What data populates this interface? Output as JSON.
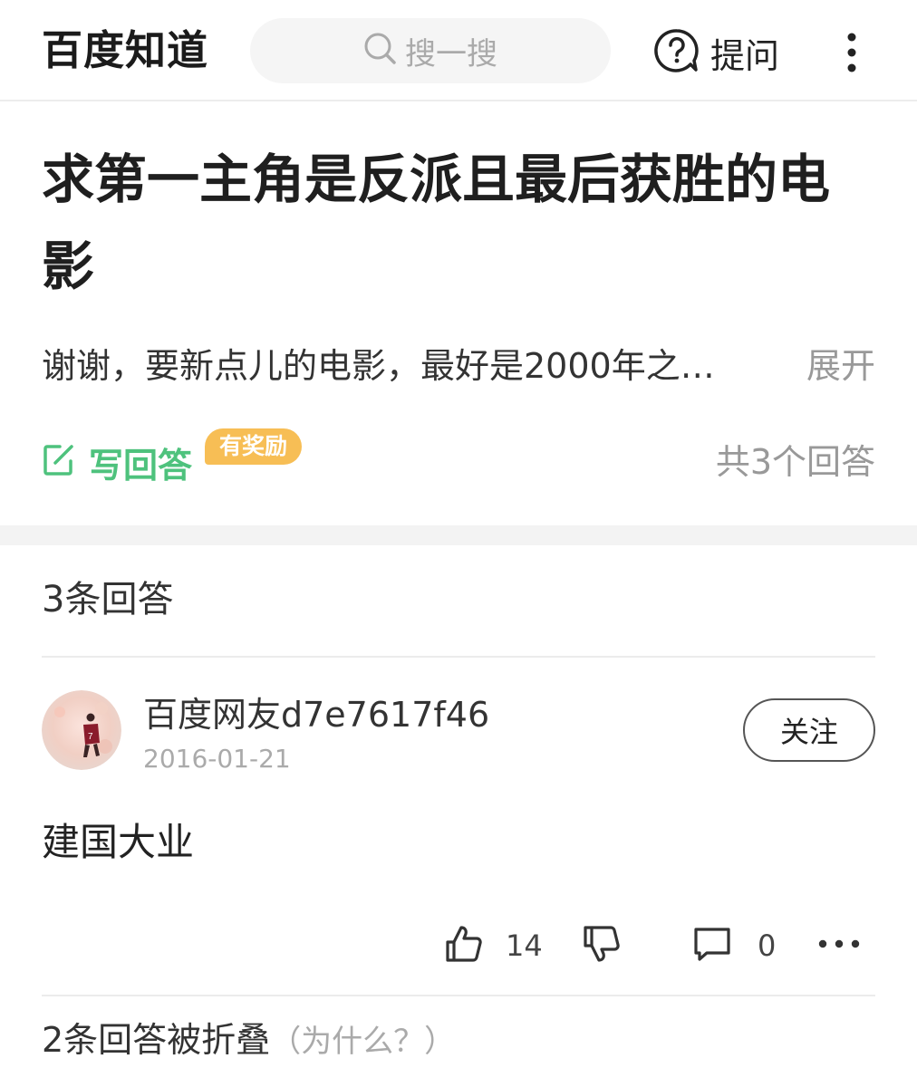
{
  "header": {
    "logo": "百度知道",
    "search_placeholder": "搜一搜",
    "ask_label": "提问"
  },
  "question": {
    "title": "求第一主角是反派且最后获胜的电影",
    "description": "谢谢，要新点儿的电影，最好是2000年之…",
    "expand_label": "展开",
    "write_answer_label": "写回答",
    "reward_badge": "有奖励",
    "answer_count": "共3个回答"
  },
  "answers": {
    "section_title": "3条回答",
    "items": [
      {
        "user_name": "百度网友d7e7617f46",
        "date": "2016-01-21",
        "follow_label": "关注",
        "content": "建国大业",
        "likes": "14",
        "comments": "0"
      }
    ],
    "folded_label": "2条回答被折叠",
    "folded_why": "（为什么？）"
  },
  "colors": {
    "accent_green": "#4ec27d",
    "reward_orange": "#f7be55"
  }
}
